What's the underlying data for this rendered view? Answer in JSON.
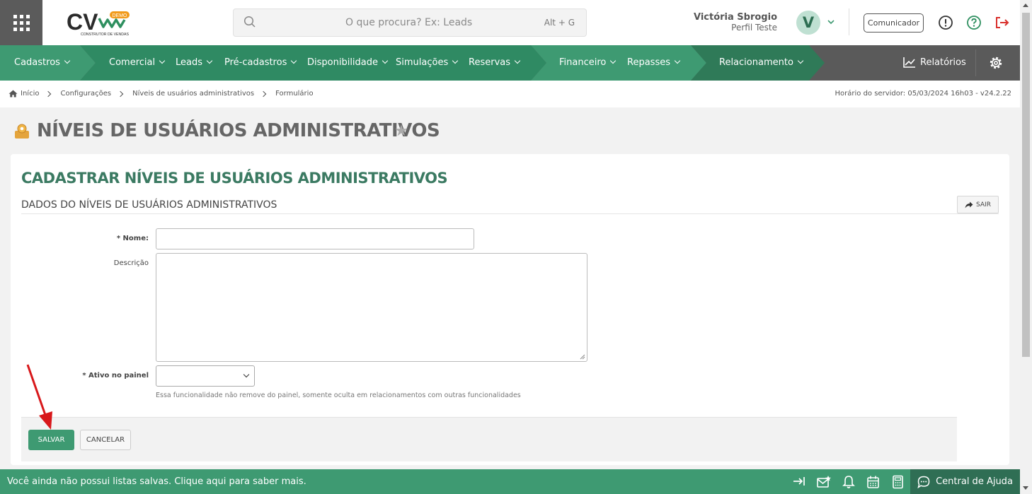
{
  "header": {
    "logo_text": "CV",
    "logo_badge": "DEMO",
    "logo_subtitle": "CONSTRUTOR DE VENDAS",
    "search_placeholder": "O que procura? Ex: Leads",
    "search_shortcut": "Alt + G",
    "user_name": "Victória Sbrogio",
    "user_profile": "Perfil Teste",
    "avatar_initial": "V",
    "communicator_label": "Comunicador"
  },
  "nav": {
    "items": [
      {
        "label": "Cadastros"
      },
      {
        "label": "Comercial"
      },
      {
        "label": "Leads"
      },
      {
        "label": "Pré-cadastros"
      },
      {
        "label": "Disponibilidade"
      },
      {
        "label": "Simulações"
      },
      {
        "label": "Reservas"
      },
      {
        "label": "Financeiro"
      },
      {
        "label": "Repasses"
      },
      {
        "label": "Relacionamento"
      }
    ],
    "reports_label": "Relatórios",
    "colors": {
      "seg1": "#3e9a72",
      "seg2": "#2f8a63",
      "seg3": "#3e9a72",
      "seg4": "#2f7a58"
    }
  },
  "breadcrumb": {
    "items": [
      "Início",
      "Configurações",
      "Níveis de usuários administrativos",
      "Formulário"
    ],
    "server_time": "Horário do servidor: 05/03/2024 16h03 - v24.2.22"
  },
  "page": {
    "title": "NÍVEIS DE USUÁRIOS ADMINISTRATIVOS",
    "form_title": "CADASTRAR NÍVEIS DE USUÁRIOS ADMINISTRATIVOS",
    "section_title": "DADOS DO NÍVEIS DE USUÁRIOS ADMINISTRATIVOS",
    "exit_label": "SAIR"
  },
  "form": {
    "name_label": "* Nome:",
    "name_value": "",
    "description_label": "Descrição",
    "description_value": "",
    "active_label": "* Ativo no painel",
    "active_value": "",
    "active_help": "Essa funcionalidade não remove do painel, somente oculta em relacionamentos com outras funcionalidades",
    "save_label": "SALVAR",
    "cancel_label": "CANCELAR"
  },
  "footer": {
    "message": "Você ainda não possui listas salvas. Clique aqui para saber mais.",
    "help_center_label": "Central de Ajuda"
  },
  "colors": {
    "brand_green": "#3e9a72",
    "dark_green": "#2f6e54",
    "title_green": "#3b7a62",
    "nav_gray": "#5a5a5a",
    "logout_red": "#d9302c",
    "arrow_red": "#d8181b"
  }
}
